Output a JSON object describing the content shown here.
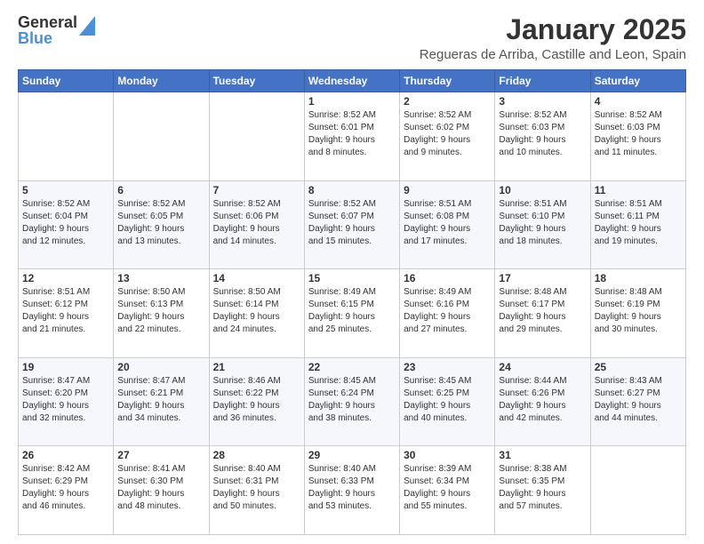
{
  "header": {
    "logo_general": "General",
    "logo_blue": "Blue",
    "month_title": "January 2025",
    "subtitle": "Regueras de Arriba, Castille and Leon, Spain"
  },
  "days_of_week": [
    "Sunday",
    "Monday",
    "Tuesday",
    "Wednesday",
    "Thursday",
    "Friday",
    "Saturday"
  ],
  "weeks": [
    [
      {
        "day": null,
        "content": null
      },
      {
        "day": null,
        "content": null
      },
      {
        "day": null,
        "content": null
      },
      {
        "day": "1",
        "content": "Sunrise: 8:52 AM\nSunset: 6:01 PM\nDaylight: 9 hours\nand 8 minutes."
      },
      {
        "day": "2",
        "content": "Sunrise: 8:52 AM\nSunset: 6:02 PM\nDaylight: 9 hours\nand 9 minutes."
      },
      {
        "day": "3",
        "content": "Sunrise: 8:52 AM\nSunset: 6:03 PM\nDaylight: 9 hours\nand 10 minutes."
      },
      {
        "day": "4",
        "content": "Sunrise: 8:52 AM\nSunset: 6:03 PM\nDaylight: 9 hours\nand 11 minutes."
      }
    ],
    [
      {
        "day": "5",
        "content": "Sunrise: 8:52 AM\nSunset: 6:04 PM\nDaylight: 9 hours\nand 12 minutes."
      },
      {
        "day": "6",
        "content": "Sunrise: 8:52 AM\nSunset: 6:05 PM\nDaylight: 9 hours\nand 13 minutes."
      },
      {
        "day": "7",
        "content": "Sunrise: 8:52 AM\nSunset: 6:06 PM\nDaylight: 9 hours\nand 14 minutes."
      },
      {
        "day": "8",
        "content": "Sunrise: 8:52 AM\nSunset: 6:07 PM\nDaylight: 9 hours\nand 15 minutes."
      },
      {
        "day": "9",
        "content": "Sunrise: 8:51 AM\nSunset: 6:08 PM\nDaylight: 9 hours\nand 17 minutes."
      },
      {
        "day": "10",
        "content": "Sunrise: 8:51 AM\nSunset: 6:10 PM\nDaylight: 9 hours\nand 18 minutes."
      },
      {
        "day": "11",
        "content": "Sunrise: 8:51 AM\nSunset: 6:11 PM\nDaylight: 9 hours\nand 19 minutes."
      }
    ],
    [
      {
        "day": "12",
        "content": "Sunrise: 8:51 AM\nSunset: 6:12 PM\nDaylight: 9 hours\nand 21 minutes."
      },
      {
        "day": "13",
        "content": "Sunrise: 8:50 AM\nSunset: 6:13 PM\nDaylight: 9 hours\nand 22 minutes."
      },
      {
        "day": "14",
        "content": "Sunrise: 8:50 AM\nSunset: 6:14 PM\nDaylight: 9 hours\nand 24 minutes."
      },
      {
        "day": "15",
        "content": "Sunrise: 8:49 AM\nSunset: 6:15 PM\nDaylight: 9 hours\nand 25 minutes."
      },
      {
        "day": "16",
        "content": "Sunrise: 8:49 AM\nSunset: 6:16 PM\nDaylight: 9 hours\nand 27 minutes."
      },
      {
        "day": "17",
        "content": "Sunrise: 8:48 AM\nSunset: 6:17 PM\nDaylight: 9 hours\nand 29 minutes."
      },
      {
        "day": "18",
        "content": "Sunrise: 8:48 AM\nSunset: 6:19 PM\nDaylight: 9 hours\nand 30 minutes."
      }
    ],
    [
      {
        "day": "19",
        "content": "Sunrise: 8:47 AM\nSunset: 6:20 PM\nDaylight: 9 hours\nand 32 minutes."
      },
      {
        "day": "20",
        "content": "Sunrise: 8:47 AM\nSunset: 6:21 PM\nDaylight: 9 hours\nand 34 minutes."
      },
      {
        "day": "21",
        "content": "Sunrise: 8:46 AM\nSunset: 6:22 PM\nDaylight: 9 hours\nand 36 minutes."
      },
      {
        "day": "22",
        "content": "Sunrise: 8:45 AM\nSunset: 6:24 PM\nDaylight: 9 hours\nand 38 minutes."
      },
      {
        "day": "23",
        "content": "Sunrise: 8:45 AM\nSunset: 6:25 PM\nDaylight: 9 hours\nand 40 minutes."
      },
      {
        "day": "24",
        "content": "Sunrise: 8:44 AM\nSunset: 6:26 PM\nDaylight: 9 hours\nand 42 minutes."
      },
      {
        "day": "25",
        "content": "Sunrise: 8:43 AM\nSunset: 6:27 PM\nDaylight: 9 hours\nand 44 minutes."
      }
    ],
    [
      {
        "day": "26",
        "content": "Sunrise: 8:42 AM\nSunset: 6:29 PM\nDaylight: 9 hours\nand 46 minutes."
      },
      {
        "day": "27",
        "content": "Sunrise: 8:41 AM\nSunset: 6:30 PM\nDaylight: 9 hours\nand 48 minutes."
      },
      {
        "day": "28",
        "content": "Sunrise: 8:40 AM\nSunset: 6:31 PM\nDaylight: 9 hours\nand 50 minutes."
      },
      {
        "day": "29",
        "content": "Sunrise: 8:40 AM\nSunset: 6:33 PM\nDaylight: 9 hours\nand 53 minutes."
      },
      {
        "day": "30",
        "content": "Sunrise: 8:39 AM\nSunset: 6:34 PM\nDaylight: 9 hours\nand 55 minutes."
      },
      {
        "day": "31",
        "content": "Sunrise: 8:38 AM\nSunset: 6:35 PM\nDaylight: 9 hours\nand 57 minutes."
      },
      {
        "day": null,
        "content": null
      }
    ]
  ]
}
